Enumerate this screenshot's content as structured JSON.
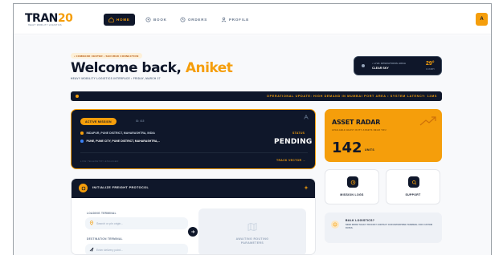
{
  "brand": {
    "logo_main": "TRAN",
    "logo_hl": "20",
    "logo_sub": "HEAVY MOBILITY LOGISTICS"
  },
  "nav": {
    "items": [
      {
        "label": "HOME",
        "icon": "home-icon",
        "active": true
      },
      {
        "label": "BOOK",
        "icon": "truck-icon",
        "active": false
      },
      {
        "label": "ORDERS",
        "icon": "clock-icon",
        "active": false
      },
      {
        "label": "PROFILE",
        "icon": "user-icon",
        "active": false
      }
    ],
    "avatar_initial": "A"
  },
  "header": {
    "breadcrumb": "• COMMAND CENTER • SECURED CONNECTION",
    "welcome_prefix": "Welcome back, ",
    "user_name": "Aniket",
    "subtitle": "HEAVY MOBILITY LOGISTICS INTERFACE • FRIDAY, MARCH 27"
  },
  "ops": {
    "label": "• LIVE OPERATIONS AREA",
    "status": "CLEAR SKY",
    "temp": "29°",
    "humidity": "0.4 KM/H"
  },
  "ticker": {
    "text": "OPERATIONAL UPDATE: HIGH DEMAND IN MUMBAI PORT AREA • SYSTEM LATENCY: 12MS"
  },
  "mission": {
    "badge": "ACTIVE MISSION",
    "id": "ID: #15",
    "origin": "INDAPUR, PUNE DISTRICT, MAHARASHTRA, INDIA",
    "destination": "PUNE, PUNE CITY, PUNE DISTRICT, MAHARASHTRA,...",
    "status_label": "STATUS",
    "status_value": "PENDING",
    "telemetry": "LIVE TELEMETRY ENGAGED",
    "track_label": "TRACK VECTOR →"
  },
  "radar": {
    "title": "ASSET RADAR",
    "subtitle": "AVAILABLE HEAVY DUTY ASSETS NEAR YOU",
    "count": "142",
    "unit": "UNITS"
  },
  "tiles": [
    {
      "label": "MISSION LOGS",
      "icon": "document-icon"
    },
    {
      "label": "SUPPORT",
      "icon": "headset-icon"
    }
  ],
  "bulk": {
    "title": "BULK LOGISTICS?",
    "body": "NEED MORE THAN 5 TRUCKS? CONTACT OUR ENTERPRISE TERMINAL FOR CUSTOM RATES."
  },
  "freight": {
    "title": "INITIALIZE FREIGHT PROTOCOL",
    "loading_label": "LOADING TERMINAL",
    "loading_placeholder": "Search or pin origin...",
    "destination_label": "DESTINATION TERMINAL",
    "destination_placeholder": "Enter delivery point...",
    "routing_line1": "AWAITING ROUTING",
    "routing_line2": "PARAMETERS"
  },
  "colors": {
    "accent": "#f59e0b",
    "navy": "#0f172a",
    "muted": "#64748b",
    "background": "#f8f9fb"
  }
}
